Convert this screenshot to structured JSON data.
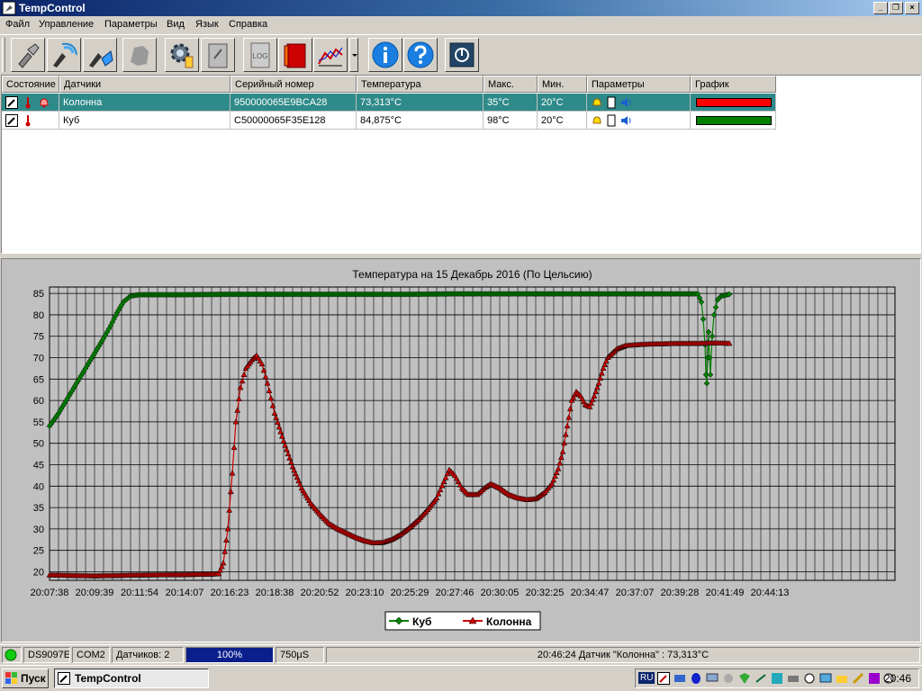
{
  "window": {
    "title": "TempControl"
  },
  "menu": [
    "Файл",
    "Управление",
    "Параметры",
    "Вид",
    "Язык",
    "Справка"
  ],
  "toolbar": {
    "buttons": [
      "connect-icon",
      "search-sensors-icon",
      "sensor-settings-icon",
      "map-icon",
      "settings-gear-icon",
      "clipboard-icon",
      "log-icon",
      "book-icon",
      "chart-icon",
      "info-icon",
      "help-icon",
      "power-icon"
    ],
    "log_label": "LOG"
  },
  "table": {
    "columns": [
      "Состояние",
      "Датчики",
      "Серийный номер",
      "Температура",
      "Макс.",
      "Мин.",
      "Параметры",
      "График"
    ],
    "rows": [
      {
        "sensor": "Колонна",
        "serial": "950000065E9BCA28",
        "temperature": "73,313°C",
        "max": "35°C",
        "min": "20°C",
        "graph_color": "#ff0000",
        "selected": true
      },
      {
        "sensor": "Куб",
        "serial": "C50000065F35E128",
        "temperature": "84,875°C",
        "max": "98°C",
        "min": "20°C",
        "graph_color": "#008000",
        "selected": false
      }
    ]
  },
  "chart_data": {
    "type": "line",
    "title": "Температура на 15 Декабрь 2016 (По Цельсию)",
    "x_ticks": [
      "20:07:38",
      "20:09:39",
      "20:11:54",
      "20:14:07",
      "20:16:23",
      "20:18:38",
      "20:20:52",
      "20:23:10",
      "20:25:29",
      "20:27:46",
      "20:30:05",
      "20:32:25",
      "20:34:47",
      "20:37:07",
      "20:39:28",
      "20:41:49",
      "20:44:13"
    ],
    "y_ticks": [
      20,
      25,
      30,
      35,
      40,
      45,
      50,
      55,
      60,
      65,
      70,
      75,
      80,
      85
    ],
    "ylim": [
      18,
      86.5
    ],
    "grid": true,
    "legend_position": "bottom-center",
    "series": [
      {
        "name": "Куб",
        "color": "#008000",
        "marker": "diamond",
        "points": [
          [
            0,
            54
          ],
          [
            1,
            57
          ],
          [
            2,
            60.5
          ],
          [
            3,
            64
          ],
          [
            4,
            67.5
          ],
          [
            5,
            71
          ],
          [
            6,
            74.5
          ],
          [
            6.8,
            77.5
          ],
          [
            7.5,
            80.5
          ],
          [
            8.2,
            83
          ],
          [
            9,
            84.4
          ],
          [
            10,
            84.7
          ],
          [
            15,
            84.7
          ],
          [
            20,
            84.8
          ],
          [
            25,
            84.8
          ],
          [
            30,
            84.8
          ],
          [
            35,
            84.8
          ],
          [
            40,
            84.8
          ],
          [
            45,
            84.9
          ],
          [
            50,
            84.9
          ],
          [
            55,
            84.9
          ],
          [
            60,
            84.9
          ],
          [
            65,
            84.9
          ],
          [
            70,
            84.9
          ],
          [
            72,
            84.9
          ],
          [
            72.4,
            83
          ],
          [
            72.6,
            79
          ],
          [
            72.8,
            73
          ],
          [
            72.9,
            66
          ],
          [
            73,
            64
          ],
          [
            73.1,
            70
          ],
          [
            73.2,
            76
          ],
          [
            73.3,
            70
          ],
          [
            73.4,
            66
          ],
          [
            73.6,
            75
          ],
          [
            73.8,
            80
          ],
          [
            74.2,
            83.5
          ],
          [
            74.6,
            84.4
          ],
          [
            75.5,
            84.8
          ]
        ]
      },
      {
        "name": "Колонна",
        "color": "#cc0000",
        "marker": "triangle",
        "points": [
          [
            0,
            19.2
          ],
          [
            5,
            19
          ],
          [
            10,
            19.2
          ],
          [
            15,
            19.3
          ],
          [
            18,
            19.4
          ],
          [
            18.8,
            19.5
          ],
          [
            19.3,
            22
          ],
          [
            19.8,
            30
          ],
          [
            20.3,
            43
          ],
          [
            20.7,
            55
          ],
          [
            21.2,
            63
          ],
          [
            21.8,
            67.5
          ],
          [
            22.5,
            69.5
          ],
          [
            23,
            70.5
          ],
          [
            23.6,
            68.5
          ],
          [
            24.2,
            64
          ],
          [
            25,
            57
          ],
          [
            26,
            50.5
          ],
          [
            27,
            44.5
          ],
          [
            28,
            39.5
          ],
          [
            29,
            36
          ],
          [
            30,
            33.5
          ],
          [
            31,
            31.3
          ],
          [
            32,
            30
          ],
          [
            33,
            29
          ],
          [
            34,
            28
          ],
          [
            35,
            27.2
          ],
          [
            36,
            26.7
          ],
          [
            37,
            26.8
          ],
          [
            38,
            27.5
          ],
          [
            39,
            28.7
          ],
          [
            40,
            30.3
          ],
          [
            41,
            32.2
          ],
          [
            42,
            34.5
          ],
          [
            43,
            37.2
          ],
          [
            43.8,
            41
          ],
          [
            44.4,
            43.8
          ],
          [
            45,
            42.5
          ],
          [
            45.8,
            39.5
          ],
          [
            46.5,
            38
          ],
          [
            47.5,
            38
          ],
          [
            48.3,
            39.5
          ],
          [
            49,
            40.5
          ],
          [
            50,
            39.5
          ],
          [
            51,
            38
          ],
          [
            52,
            37.2
          ],
          [
            53,
            36.8
          ],
          [
            54,
            37
          ],
          [
            55,
            38.5
          ],
          [
            55.8,
            40.5
          ],
          [
            56.5,
            44
          ],
          [
            57,
            48
          ],
          [
            57.5,
            54
          ],
          [
            58,
            60
          ],
          [
            58.5,
            62
          ],
          [
            59,
            61
          ],
          [
            59.5,
            59
          ],
          [
            60,
            58.5
          ],
          [
            60.5,
            61
          ],
          [
            61,
            64
          ],
          [
            61.5,
            67.5
          ],
          [
            62,
            70
          ],
          [
            63,
            72
          ],
          [
            64,
            72.8
          ],
          [
            66,
            73.1
          ],
          [
            68,
            73.2
          ],
          [
            70,
            73.3
          ],
          [
            72,
            73.3
          ],
          [
            74,
            73.4
          ],
          [
            75.5,
            73.3
          ]
        ]
      }
    ]
  },
  "status": {
    "model": "DS9097E",
    "port": "COM2",
    "sensors": "Датчиков: 2",
    "progress_value": 100,
    "progress_text": "100%",
    "interval": "750μS",
    "message": "20:46:24 Датчик \"Колонна\" : 73,313°C"
  },
  "taskbar": {
    "start": "Пуск",
    "task": "TempControl",
    "lang": "RU",
    "clock": "20:46"
  }
}
